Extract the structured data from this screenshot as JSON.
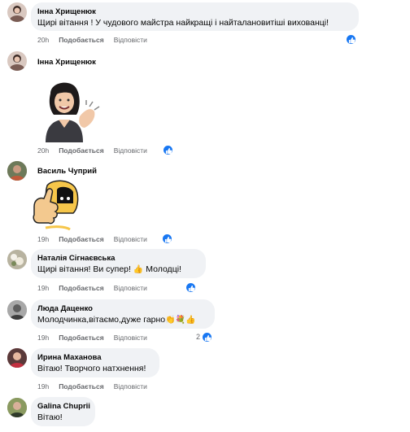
{
  "comments": [
    {
      "author": "Інна Хрищенюк",
      "text": "Щирі вітання ! У чудового майстра найкращі і найталановитіші вихованці!",
      "time": "20h",
      "like": "Подобається",
      "reply": "Відповісти"
    },
    {
      "author": "Інна Хрищенюк",
      "time": "20h",
      "like": "Подобається",
      "reply": "Відповісти"
    },
    {
      "author": "Василь Чуприй",
      "time": "19h",
      "like": "Подобається",
      "reply": "Відповісти"
    },
    {
      "author": "Наталія Сігнаєвська",
      "text": "Щирі вітання! Ви супер!",
      "text2": "Молодці!",
      "time": "19h",
      "like": "Подобається",
      "reply": "Відповісти"
    },
    {
      "author": "Люда Даценко",
      "text": "Молодчинка,вітаємо,дуже гарно",
      "time": "19h",
      "like": "Подобається",
      "reply": "Відповісти",
      "reactions": "2"
    },
    {
      "author": "Ирина Маханова",
      "text": "Вітаю! Творчого натхнення!",
      "time": "19h",
      "like": "Подобається",
      "reply": "Відповісти"
    },
    {
      "author": "Galina Chuprii",
      "text": "Вітаю!"
    }
  ],
  "icons": {
    "like": "like-reaction-icon",
    "sticker_woman": "clapping-woman-sticker",
    "sticker_cat": "thumbs-up-cat-sticker"
  },
  "colors": {
    "bubble": "#f0f2f5",
    "like_blue": "#1877f2",
    "meta": "#65676b"
  }
}
